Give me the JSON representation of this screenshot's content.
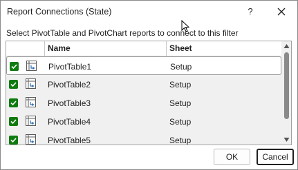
{
  "window": {
    "title": "Report Connections (State)",
    "help_label": "?"
  },
  "instruction": "Select PivotTable and PivotChart reports to connect to this filter",
  "listview": {
    "columns": [
      "Name",
      "Sheet"
    ],
    "rows": [
      {
        "name": "PivotTable1",
        "sheet": "Setup",
        "checked": true,
        "selected": true
      },
      {
        "name": "PivotTable2",
        "sheet": "Setup",
        "checked": true,
        "selected": false
      },
      {
        "name": "PivotTable3",
        "sheet": "Setup",
        "checked": true,
        "selected": false
      },
      {
        "name": "PivotTable4",
        "sheet": "Setup",
        "checked": true,
        "selected": false
      },
      {
        "name": "PivotTable5",
        "sheet": "Setup",
        "checked": true,
        "selected": false
      }
    ]
  },
  "buttons": {
    "ok": "OK",
    "cancel": "Cancel"
  },
  "colors": {
    "checkbox": "#0f7b0f",
    "scroll_thumb": "#8a8a8a",
    "list_background": "#f0f0f0"
  },
  "icons": [
    "close-icon",
    "checkbox-checked-icon",
    "pivottable-icon",
    "scroll-up-arrow-icon",
    "scroll-down-arrow-icon",
    "mouse-cursor-icon"
  ]
}
